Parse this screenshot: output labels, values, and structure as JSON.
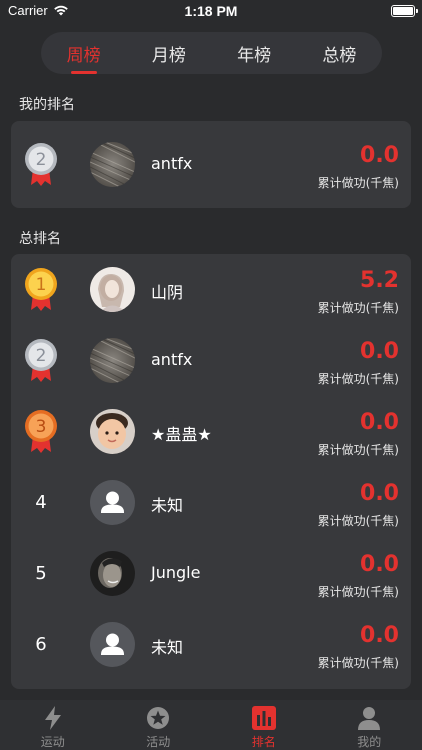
{
  "status_bar": {
    "carrier": "Carrier",
    "time": "1:18 PM"
  },
  "period_tabs": [
    {
      "label": "周榜",
      "active": true
    },
    {
      "label": "月榜",
      "active": false
    },
    {
      "label": "年榜",
      "active": false
    },
    {
      "label": "总榜",
      "active": false
    }
  ],
  "my_rank": {
    "title": "我的排名",
    "row": {
      "rank": "2",
      "name": "antfx",
      "score": "0.0",
      "score_label": "累计做功(千焦)",
      "avatar": "texture-avatar"
    }
  },
  "overall": {
    "title": "总排名",
    "rows": [
      {
        "rank": "1",
        "name": "山阴",
        "score": "5.2",
        "score_label": "累计做功(千焦)",
        "avatar": "girl-photo-avatar"
      },
      {
        "rank": "2",
        "name": "antfx",
        "score": "0.0",
        "score_label": "累计做功(千焦)",
        "avatar": "texture-avatar"
      },
      {
        "rank": "3",
        "name": "★蛊蛊★",
        "score": "0.0",
        "score_label": "累计做功(千焦)",
        "avatar": "baby-photo-avatar"
      },
      {
        "rank": "4",
        "name": "未知",
        "score": "0.0",
        "score_label": "累计做功(千焦)",
        "avatar": "default-user-avatar"
      },
      {
        "rank": "5",
        "name": "Jungle",
        "score": "0.0",
        "score_label": "累计做功(千焦)",
        "avatar": "man-photo-avatar"
      },
      {
        "rank": "6",
        "name": "未知",
        "score": "0.0",
        "score_label": "累计做功(千焦)",
        "avatar": "default-user-avatar"
      }
    ]
  },
  "tabbar": [
    {
      "label": "运动",
      "icon": "lightning-icon",
      "active": false
    },
    {
      "label": "活动",
      "icon": "star-circle-icon",
      "active": false
    },
    {
      "label": "排名",
      "icon": "bar-chart-icon",
      "active": true
    },
    {
      "label": "我的",
      "icon": "person-icon",
      "active": false
    }
  ],
  "colors": {
    "accent": "#e3322f",
    "background": "#2a2b2d",
    "card": "#38393c",
    "gold": "#f5b82a",
    "silver": "#cfd2d6",
    "bronze": "#f08a3c"
  }
}
